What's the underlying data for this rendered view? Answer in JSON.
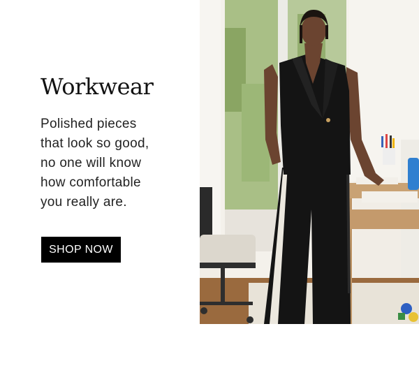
{
  "promo": {
    "headline": "Workwear",
    "body": "Polished pieces\nthat look so good,\nno one will know\nhow comfortable\nyou really are.",
    "cta_label": "SHOP NOW"
  },
  "photo": {
    "subject": "woman-in-black-vest-and-wide-leg-trousers",
    "colors": {
      "suit": "#141414",
      "stripe": "#ece8df",
      "wall": "#f3f0ea",
      "wood": "#c9a274",
      "floor": "#9a6a3e"
    }
  }
}
